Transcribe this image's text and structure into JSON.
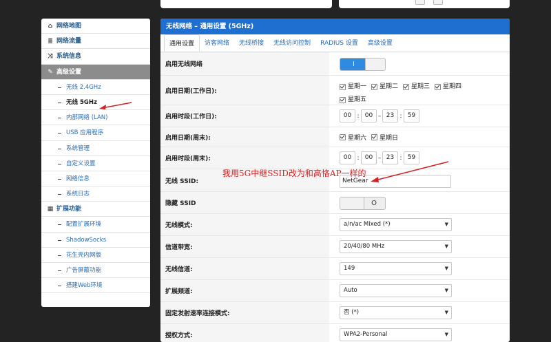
{
  "sidebar": {
    "items": [
      {
        "type": "group",
        "icon": "home-icon",
        "glyph": "⌂",
        "label": "网络地图"
      },
      {
        "type": "group",
        "icon": "traffic-icon",
        "glyph": "≣",
        "label": "网络流量"
      },
      {
        "type": "group",
        "icon": "shuffle-icon",
        "glyph": "⤨",
        "label": "系统信息"
      },
      {
        "type": "group",
        "icon": "wrench-icon",
        "glyph": "✎",
        "label": "高级设置",
        "active": true
      },
      {
        "type": "sub",
        "label": "无线 2.4GHz"
      },
      {
        "type": "sub",
        "label": "无线 5GHz",
        "current": true
      },
      {
        "type": "sub",
        "label": "内部网络 (LAN)"
      },
      {
        "type": "sub",
        "label": "USB 应用程序"
      },
      {
        "type": "sub",
        "label": "系统管理"
      },
      {
        "type": "sub",
        "label": "自定义设置"
      },
      {
        "type": "sub",
        "label": "网络信息"
      },
      {
        "type": "sub",
        "label": "系统日志"
      },
      {
        "type": "group",
        "icon": "grid-icon",
        "glyph": "▦",
        "label": "扩展功能"
      },
      {
        "type": "sub",
        "label": "配置扩展环境"
      },
      {
        "type": "sub",
        "label": "ShadowSocks"
      },
      {
        "type": "sub",
        "label": "花生壳内网版"
      },
      {
        "type": "sub",
        "label": "广告屏蔽功能"
      },
      {
        "type": "sub",
        "label": "搭建Web环境"
      }
    ]
  },
  "panel": {
    "title": "无线网络 – 通用设置 (5GHz)",
    "tabs": [
      "通用设置",
      "访客网络",
      "无线桥接",
      "无线访问控制",
      "RADIUS 设置",
      "高级设置"
    ],
    "active_tab": 0,
    "rows": {
      "enable_wifi": {
        "label": "启用无线网络",
        "toggle_on": true,
        "on_glyph": "I"
      },
      "weekdays": {
        "label": "启用日期(工作日):",
        "days": [
          "星期一",
          "星期二",
          "星期三",
          "星期四",
          "星期五"
        ]
      },
      "weekday_time": {
        "label": "启用时段(工作日):",
        "start_h": "00",
        "start_m": "00",
        "end_h": "23",
        "end_m": "59",
        "sep": ":",
        "dash": "–"
      },
      "weekend": {
        "label": "启用日期(周末):",
        "days": [
          "星期六",
          "星期日"
        ]
      },
      "weekend_time": {
        "label": "启用时段(周末):",
        "start_h": "00",
        "start_m": "00",
        "end_h": "23",
        "end_m": "59",
        "sep": ":",
        "dash": "–"
      },
      "ssid": {
        "label": "无线 SSID:",
        "value": "NetGear"
      },
      "hide_ssid": {
        "label": "隐藏 SSID",
        "toggle_on": false,
        "off_glyph": "O"
      },
      "mode": {
        "label": "无线模式:",
        "value": "a/n/ac Mixed (*)"
      },
      "bandwidth": {
        "label": "信道带宽:",
        "value": "20/40/80 MHz"
      },
      "channel": {
        "label": "无线信道:",
        "value": "149"
      },
      "ext_channel": {
        "label": "扩展频道:",
        "value": "Auto"
      },
      "fixed_rate": {
        "label": "固定发射速率连接模式:",
        "value": "否 (*)"
      },
      "auth": {
        "label": "授权方式:",
        "value": "WPA2-Personal"
      }
    }
  },
  "annotation": {
    "text": "我用5G中继SSID改为和高恪AP一样的",
    "color": "#d42020"
  },
  "colors": {
    "accent": "#1e6fd0",
    "toggle_on": "#2f8ae0",
    "sidebar_active": "#8c8c8c",
    "link": "#2a6bb0"
  }
}
